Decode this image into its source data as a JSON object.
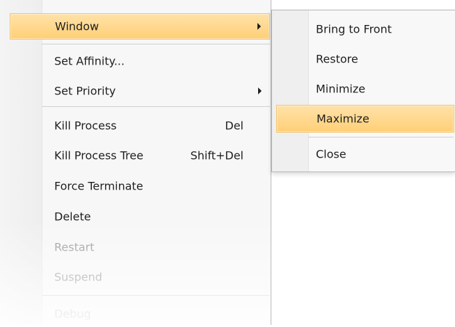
{
  "context_menu": {
    "items": [
      {
        "label": "Window",
        "shortcut": "",
        "submenu_arrow": true,
        "state": "highlighted"
      },
      {
        "label": "Set Affinity...",
        "shortcut": "",
        "submenu_arrow": false,
        "state": "normal"
      },
      {
        "label": "Set Priority",
        "shortcut": "",
        "submenu_arrow": true,
        "state": "normal"
      },
      {
        "label": "Kill Process",
        "shortcut": "Del",
        "submenu_arrow": false,
        "state": "normal"
      },
      {
        "label": "Kill Process Tree",
        "shortcut": "Shift+Del",
        "submenu_arrow": false,
        "state": "normal"
      },
      {
        "label": "Force Terminate",
        "shortcut": "",
        "submenu_arrow": false,
        "state": "normal"
      },
      {
        "label": "Delete",
        "shortcut": "",
        "submenu_arrow": false,
        "state": "normal"
      },
      {
        "label": "Restart",
        "shortcut": "",
        "submenu_arrow": false,
        "state": "disabled"
      },
      {
        "label": "Suspend",
        "shortcut": "",
        "submenu_arrow": false,
        "state": "disabled"
      },
      {
        "label": "Debug",
        "shortcut": "",
        "submenu_arrow": false,
        "state": "disabled"
      }
    ]
  },
  "window_submenu": {
    "items": [
      {
        "label": "Bring to Front",
        "state": "normal"
      },
      {
        "label": "Restore",
        "state": "normal"
      },
      {
        "label": "Minimize",
        "state": "normal"
      },
      {
        "label": "Maximize",
        "state": "highlighted"
      },
      {
        "label": "Close",
        "state": "normal"
      }
    ]
  },
  "colors": {
    "highlight": "#ffcf77",
    "menu_background": "#f7f7f7",
    "separator": "#cfcfcf",
    "disabled_text": "#9b9b9b"
  }
}
